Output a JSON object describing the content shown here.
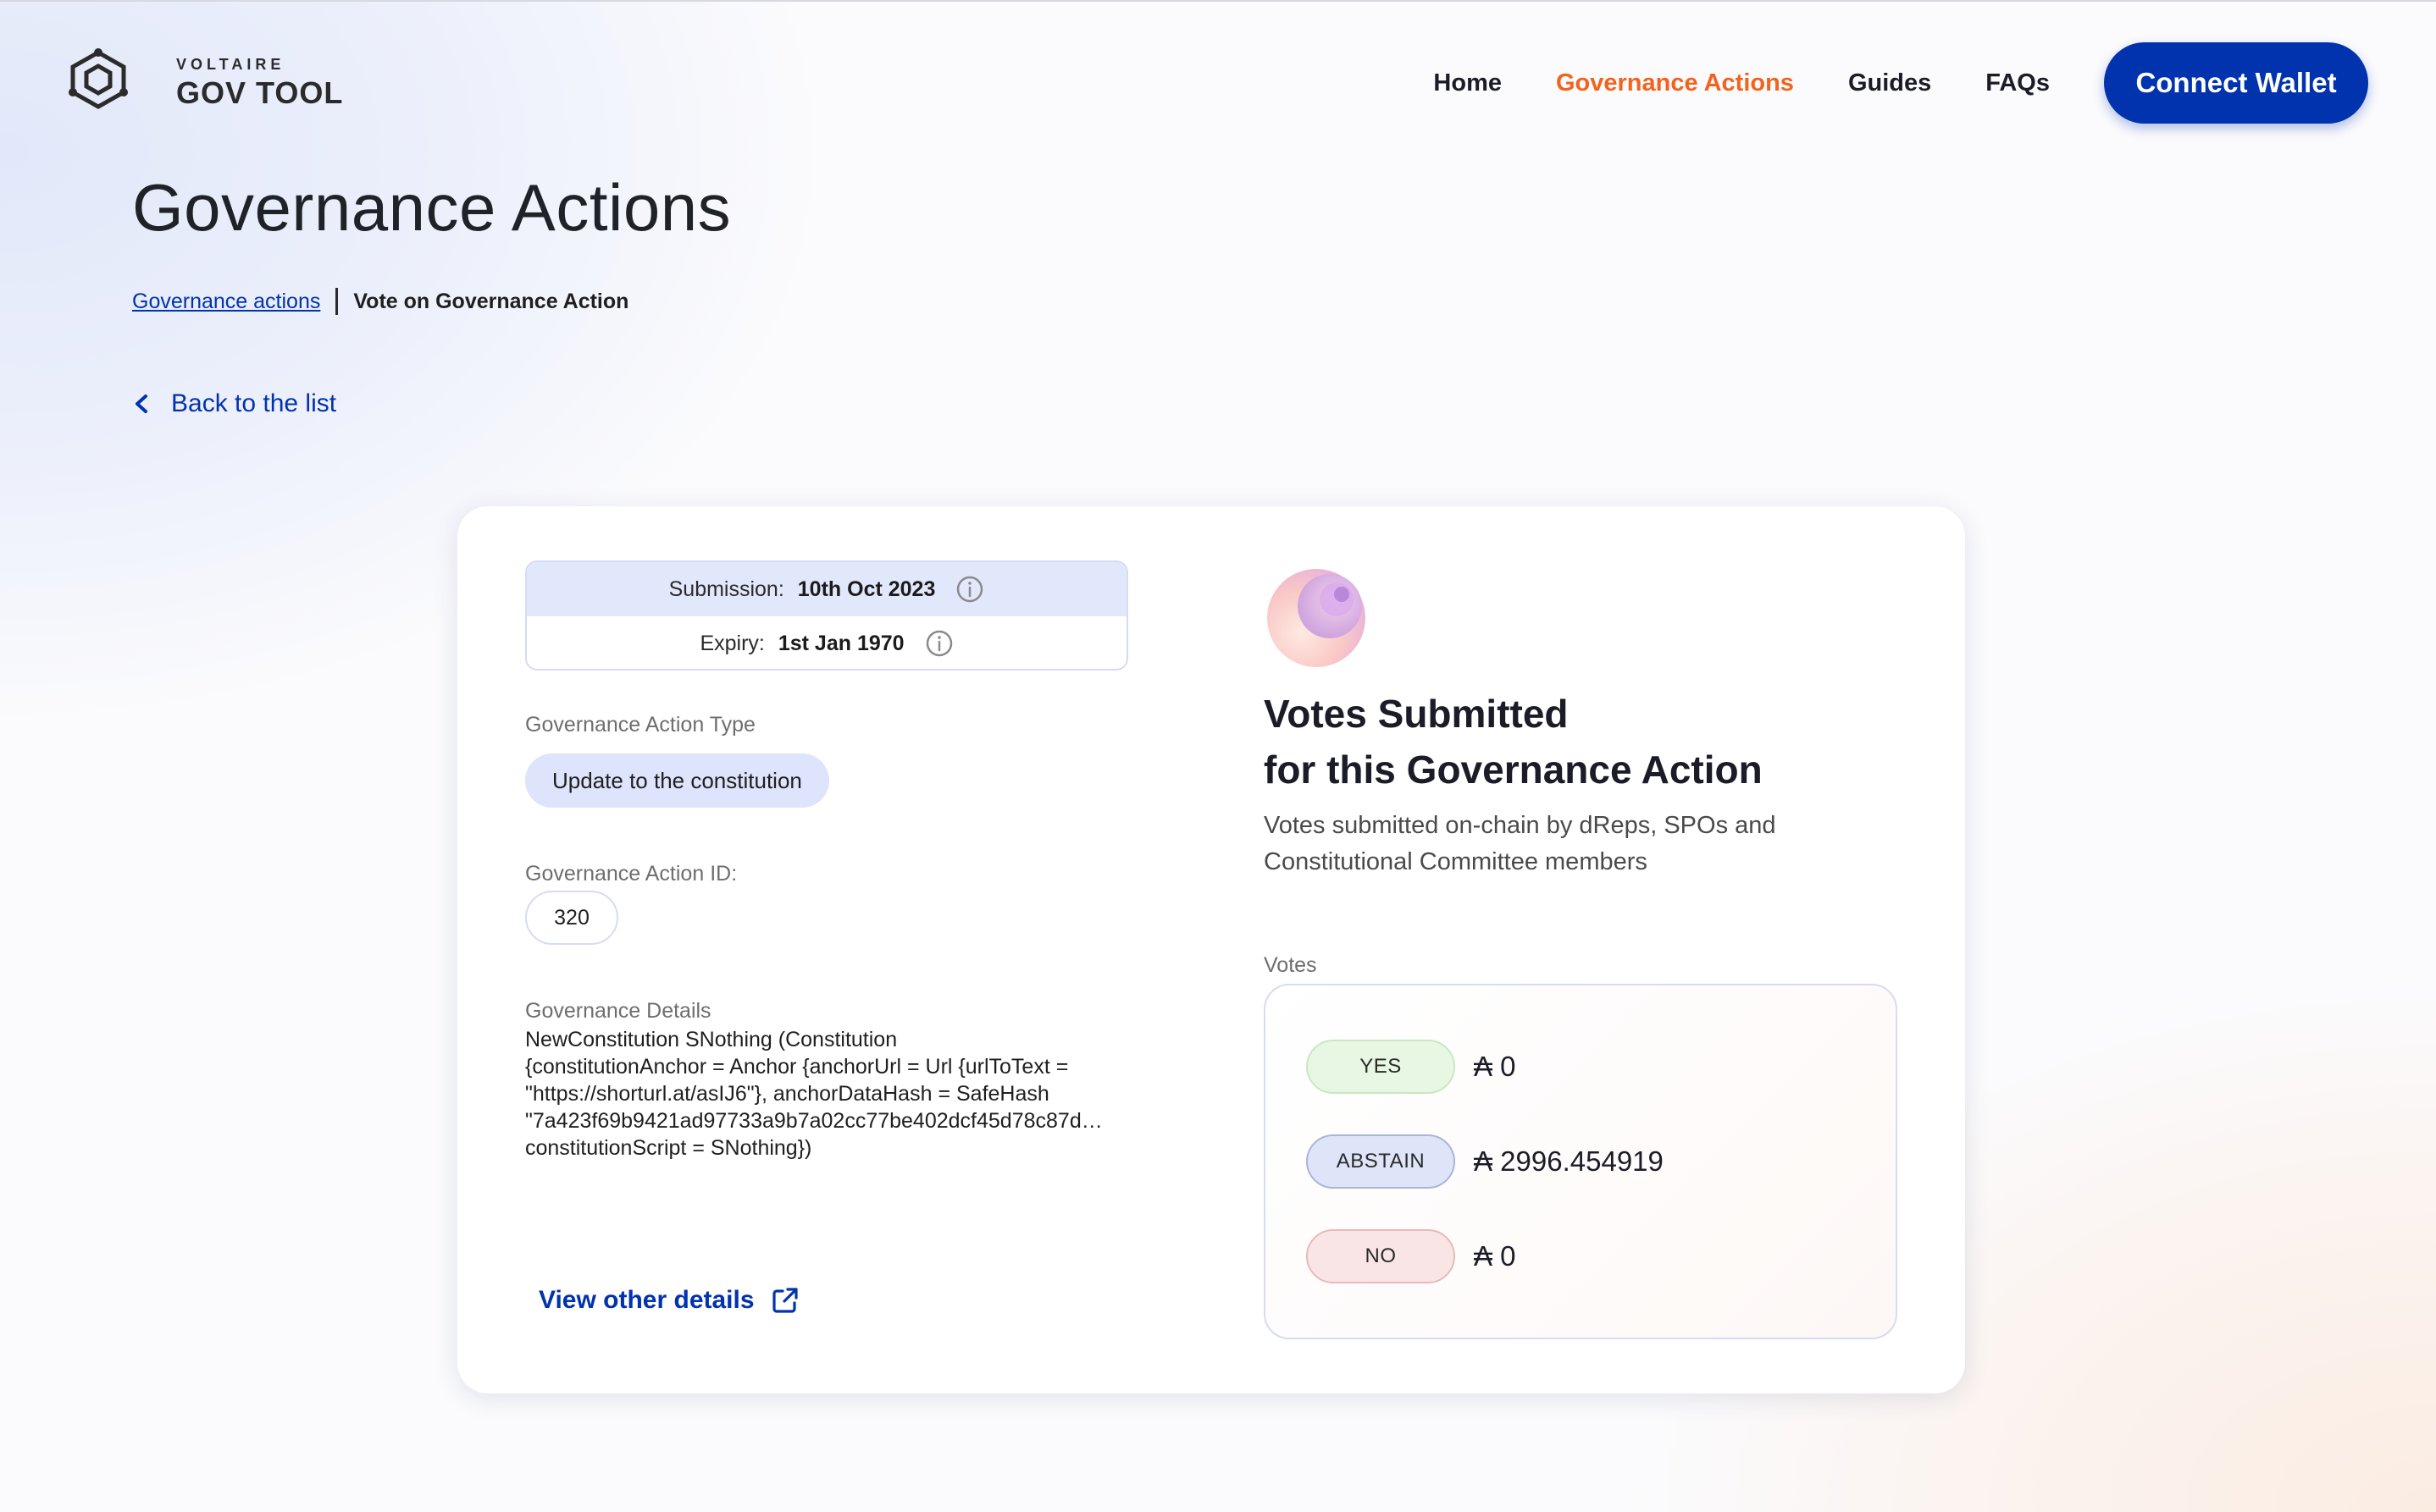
{
  "brand": {
    "top": "VOLTAIRE",
    "bottom": "GOV TOOL"
  },
  "nav": {
    "items": [
      {
        "label": "Home",
        "active": false
      },
      {
        "label": "Governance Actions",
        "active": true
      },
      {
        "label": "Guides",
        "active": false
      },
      {
        "label": "FAQs",
        "active": false
      }
    ],
    "connect_label": "Connect Wallet"
  },
  "page": {
    "title": "Governance Actions",
    "breadcrumb": {
      "link": "Governance actions",
      "current": "Vote on Governance Action"
    },
    "back_label": "Back to the list"
  },
  "action": {
    "submission_label": "Submission:",
    "submission_value": "10th Oct 2023",
    "expiry_label": "Expiry:",
    "expiry_value": "1st Jan 1970",
    "type_label": "Governance Action Type",
    "type_value": "Update to the constitution",
    "id_label": "Governance Action ID:",
    "id_value": "320",
    "details_label": "Governance Details",
    "details_lines": [
      "NewConstitution SNothing (Constitution",
      "{constitutionAnchor = Anchor {anchorUrl = Url {urlToText =",
      "\"https://shorturl.at/asIJ6\"}, anchorDataHash = SafeHash",
      "\"7a423f69b9421ad97733a9b7a02cc77be402dcf45d78c87d…",
      "constitutionScript = SNothing})"
    ],
    "view_details_label": "View other details"
  },
  "votes": {
    "title_line1": "Votes Submitted",
    "title_line2": "for this Governance Action",
    "description": "Votes submitted on-chain by dReps, SPOs and Constitutional Committee members",
    "label": "Votes",
    "rows": [
      {
        "label": "YES",
        "amount": "₳ 0",
        "color": "#e8f6e4"
      },
      {
        "label": "ABSTAIN",
        "amount": "₳ 2996.454919",
        "color": "#dfe5f8"
      },
      {
        "label": "NO",
        "amount": "₳ 0",
        "color": "#f9e5e5"
      }
    ]
  },
  "colors": {
    "accent": "#0033ad",
    "active_nav": "#f2641e"
  },
  "icons": [
    "voltaire-logo-icon",
    "chevron-left-icon",
    "info-icon",
    "external-link-icon",
    "votes-blob-icon"
  ]
}
